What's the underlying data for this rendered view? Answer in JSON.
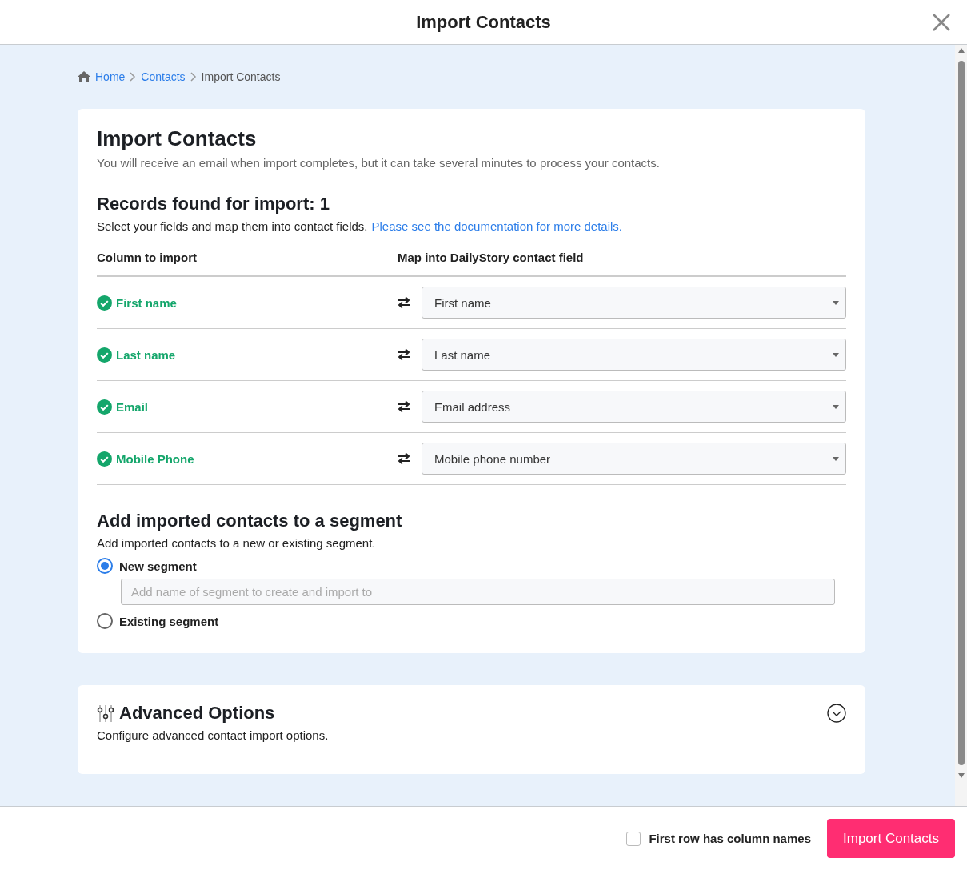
{
  "window": {
    "title": "Import Contacts"
  },
  "breadcrumb": [
    {
      "label": "Home",
      "kind": "link"
    },
    {
      "label": "Contacts",
      "kind": "link"
    },
    {
      "label": "Import Contacts",
      "kind": "current"
    }
  ],
  "import_card": {
    "title": "Import Contacts",
    "description": "You will receive an email when import completes, but it can take several minutes to process your contacts.",
    "records_heading": "Records found for import: 1",
    "instruction": "Select your fields and map them into contact fields.",
    "doc_link": "Please see the documentation for more details.",
    "columns": [
      "Column to import",
      "Map into DailyStory contact field"
    ],
    "mappings": [
      {
        "column": "First name",
        "matched": true,
        "field": "First name"
      },
      {
        "column": "Last name",
        "matched": true,
        "field": "Last name"
      },
      {
        "column": "Email",
        "matched": true,
        "field": "Email address"
      },
      {
        "column": "Mobile Phone",
        "matched": true,
        "field": "Mobile phone number"
      }
    ]
  },
  "segment": {
    "heading": "Add imported contacts to a segment",
    "description": "Add imported contacts to a new or existing segment.",
    "options": [
      {
        "label": "New segment",
        "selected": true,
        "placeholder": "Add name of segment to create and import to"
      },
      {
        "label": "Existing segment",
        "selected": false
      }
    ]
  },
  "advanced": {
    "title": "Advanced Options",
    "description": "Configure advanced contact import options.",
    "expanded": false
  },
  "footer": {
    "checkbox": {
      "label": "First row has column names",
      "checked": false
    },
    "button": "Import Contacts"
  }
}
